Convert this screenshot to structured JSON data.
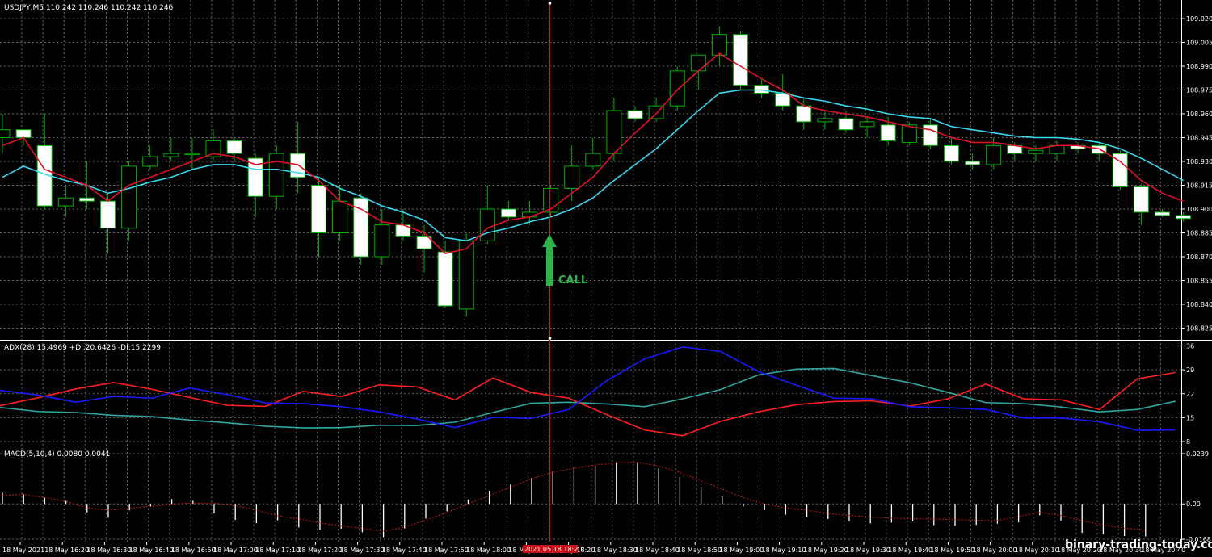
{
  "main": {
    "header": "USDJPY,M5  110.242 110.246 110.242 110.246",
    "price_ticks": [
      "109.020",
      "109.005",
      "108.990",
      "108.975",
      "108.960",
      "108.945",
      "108.930",
      "108.915",
      "108.900",
      "108.885",
      "108.870",
      "108.855",
      "108.840",
      "108.825"
    ],
    "call_label": "CALL"
  },
  "adx_panel": {
    "header": "ADX(28) 15.4969 +DI:20.6426 -DI:15.2299",
    "ticks": [
      "36",
      "29",
      "22",
      "15",
      "8"
    ]
  },
  "macd_panel": {
    "header": "MACD(5,10,4) 0.0080 0.0041",
    "ticks": [
      "0.0239",
      "0.00",
      "-0.0168"
    ]
  },
  "time_axis": {
    "labels": [
      "18 May 2021",
      "18 May 16:20",
      "18 May 16:30",
      "18 May 16:40",
      "18 May 16:50",
      "18 May 17:00",
      "18 May 17:10",
      "18 May 17:20",
      "18 May 17:30",
      "18 May 17:40",
      "18 May 17:50",
      "18 May 18:00",
      "18 May 18:10",
      "18 May 18:20",
      "18 May 18:30",
      "18 May 18:40",
      "18 May 18:50",
      "18 May 19:00",
      "18 May 19:10",
      "18 May 19:20",
      "18 May 19:30",
      "18 May 19:40",
      "18 May 19:50",
      "18 May 20:00",
      "18 May 20:10",
      "18 May 20:20",
      "18 May 20:30",
      "18 May 20:40"
    ],
    "highlight": "2021.05.18 18:20"
  },
  "watermark": "binary-trading-today.com",
  "colors": {
    "background": "#000000",
    "grid": "#8a8a8a",
    "bull": "#00b400",
    "bear_body": "#ffffff",
    "ma_fast": "#e0102a",
    "ma_slow": "#38d7ee",
    "adx": "#2fa7a0",
    "plus_di": "#1a1aff",
    "minus_di": "#ff1f1f",
    "macd_hist": "#ffffff",
    "macd_signal": "#c01818",
    "cursor": "#d01515",
    "call": "#2db34a"
  },
  "chart_data": {
    "type": "candlestick",
    "symbol": "USDJPY",
    "timeframe": "M5",
    "candles": [
      {
        "o": 108.945,
        "h": 108.96,
        "l": 108.935,
        "c": 108.95
      },
      {
        "o": 108.95,
        "h": 108.95,
        "l": 108.94,
        "c": 108.945
      },
      {
        "o": 108.94,
        "h": 108.96,
        "l": 108.9,
        "c": 108.902
      },
      {
        "o": 108.902,
        "h": 108.915,
        "l": 108.895,
        "c": 108.907
      },
      {
        "o": 108.907,
        "h": 108.93,
        "l": 108.9,
        "c": 108.905
      },
      {
        "o": 108.905,
        "h": 108.91,
        "l": 108.872,
        "c": 108.888
      },
      {
        "o": 108.888,
        "h": 108.93,
        "l": 108.88,
        "c": 108.927
      },
      {
        "o": 108.927,
        "h": 108.94,
        "l": 108.925,
        "c": 108.933
      },
      {
        "o": 108.933,
        "h": 108.945,
        "l": 108.93,
        "c": 108.935
      },
      {
        "o": 108.935,
        "h": 108.945,
        "l": 108.925,
        "c": 108.935
      },
      {
        "o": 108.933,
        "h": 108.95,
        "l": 108.93,
        "c": 108.943
      },
      {
        "o": 108.943,
        "h": 108.945,
        "l": 108.93,
        "c": 108.935
      },
      {
        "o": 108.932,
        "h": 108.935,
        "l": 108.895,
        "c": 108.908
      },
      {
        "o": 108.908,
        "h": 108.94,
        "l": 108.9,
        "c": 108.935
      },
      {
        "o": 108.935,
        "h": 108.955,
        "l": 108.91,
        "c": 108.92
      },
      {
        "o": 108.915,
        "h": 108.92,
        "l": 108.87,
        "c": 108.885
      },
      {
        "o": 108.885,
        "h": 108.915,
        "l": 108.88,
        "c": 108.905
      },
      {
        "o": 108.907,
        "h": 108.91,
        "l": 108.865,
        "c": 108.87
      },
      {
        "o": 108.87,
        "h": 108.9,
        "l": 108.865,
        "c": 108.89
      },
      {
        "o": 108.89,
        "h": 108.9,
        "l": 108.88,
        "c": 108.883
      },
      {
        "o": 108.883,
        "h": 108.89,
        "l": 108.86,
        "c": 108.875
      },
      {
        "o": 108.873,
        "h": 108.88,
        "l": 108.838,
        "c": 108.839
      },
      {
        "o": 108.837,
        "h": 108.885,
        "l": 108.832,
        "c": 108.88
      },
      {
        "o": 108.88,
        "h": 108.915,
        "l": 108.878,
        "c": 108.9
      },
      {
        "o": 108.9,
        "h": 108.905,
        "l": 108.893,
        "c": 108.895
      },
      {
        "o": 108.895,
        "h": 108.905,
        "l": 108.89,
        "c": 108.898
      },
      {
        "o": 108.898,
        "h": 108.915,
        "l": 108.895,
        "c": 108.913
      },
      {
        "o": 108.913,
        "h": 108.94,
        "l": 108.905,
        "c": 108.927
      },
      {
        "o": 108.927,
        "h": 108.945,
        "l": 108.925,
        "c": 108.935
      },
      {
        "o": 108.935,
        "h": 108.97,
        "l": 108.93,
        "c": 108.962
      },
      {
        "o": 108.962,
        "h": 108.965,
        "l": 108.955,
        "c": 108.957
      },
      {
        "o": 108.957,
        "h": 108.97,
        "l": 108.955,
        "c": 108.965
      },
      {
        "o": 108.965,
        "h": 108.99,
        "l": 108.962,
        "c": 108.987
      },
      {
        "o": 108.987,
        "h": 108.995,
        "l": 108.975,
        "c": 108.997
      },
      {
        "o": 108.997,
        "h": 109.015,
        "l": 108.99,
        "c": 109.01
      },
      {
        "o": 109.01,
        "h": 109.012,
        "l": 108.975,
        "c": 108.978
      },
      {
        "o": 108.978,
        "h": 108.982,
        "l": 108.97,
        "c": 108.973
      },
      {
        "o": 108.973,
        "h": 108.985,
        "l": 108.962,
        "c": 108.965
      },
      {
        "o": 108.965,
        "h": 108.97,
        "l": 108.95,
        "c": 108.955
      },
      {
        "o": 108.955,
        "h": 108.962,
        "l": 108.95,
        "c": 108.957
      },
      {
        "o": 108.957,
        "h": 108.962,
        "l": 108.948,
        "c": 108.95
      },
      {
        "o": 108.952,
        "h": 108.958,
        "l": 108.945,
        "c": 108.955
      },
      {
        "o": 108.953,
        "h": 108.958,
        "l": 108.94,
        "c": 108.943
      },
      {
        "o": 108.942,
        "h": 108.955,
        "l": 108.94,
        "c": 108.953
      },
      {
        "o": 108.953,
        "h": 108.957,
        "l": 108.938,
        "c": 108.94
      },
      {
        "o": 108.94,
        "h": 108.945,
        "l": 108.928,
        "c": 108.93
      },
      {
        "o": 108.93,
        "h": 108.935,
        "l": 108.925,
        "c": 108.928
      },
      {
        "o": 108.928,
        "h": 108.945,
        "l": 108.925,
        "c": 108.94
      },
      {
        "o": 108.94,
        "h": 108.942,
        "l": 108.93,
        "c": 108.935
      },
      {
        "o": 108.935,
        "h": 108.94,
        "l": 108.93,
        "c": 108.937
      },
      {
        "o": 108.935,
        "h": 108.943,
        "l": 108.93,
        "c": 108.94
      },
      {
        "o": 108.94,
        "h": 108.942,
        "l": 108.935,
        "c": 108.938
      },
      {
        "o": 108.94,
        "h": 108.942,
        "l": 108.93,
        "c": 108.935
      },
      {
        "o": 108.935,
        "h": 108.937,
        "l": 108.912,
        "c": 108.914
      },
      {
        "o": 108.914,
        "h": 108.916,
        "l": 108.89,
        "c": 108.898
      },
      {
        "o": 108.898,
        "h": 108.9,
        "l": 108.895,
        "c": 108.896
      },
      {
        "o": 108.896,
        "h": 108.898,
        "l": 108.892,
        "c": 108.894
      }
    ],
    "ma_fast": [
      108.94,
      108.945,
      108.925,
      108.92,
      108.915,
      108.905,
      108.915,
      108.92,
      108.925,
      108.93,
      108.935,
      108.933,
      108.928,
      108.93,
      108.928,
      108.918,
      108.905,
      108.9,
      108.892,
      108.89,
      108.885,
      108.872,
      108.875,
      108.888,
      108.893,
      108.895,
      108.9,
      108.91,
      108.92,
      108.935,
      108.948,
      108.96,
      108.975,
      108.987,
      108.998,
      108.99,
      108.982,
      108.975,
      108.965,
      108.962,
      108.96,
      108.958,
      108.955,
      108.952,
      108.95,
      108.945,
      108.942,
      108.942,
      108.94,
      108.938,
      108.94,
      108.94,
      108.938,
      108.93,
      108.918,
      108.91,
      108.905
    ],
    "ma_slow": [
      108.92,
      108.927,
      108.922,
      108.918,
      108.915,
      108.91,
      108.913,
      108.917,
      108.92,
      108.925,
      108.928,
      108.928,
      108.925,
      108.925,
      108.923,
      108.92,
      108.913,
      108.908,
      108.902,
      108.898,
      108.893,
      108.882,
      108.88,
      108.885,
      108.888,
      108.892,
      108.895,
      108.9,
      108.907,
      108.918,
      108.928,
      108.938,
      108.95,
      108.962,
      108.973,
      108.975,
      108.975,
      108.973,
      108.97,
      108.968,
      108.965,
      108.963,
      108.96,
      108.958,
      108.957,
      108.952,
      108.95,
      108.948,
      108.946,
      108.945,
      108.945,
      108.944,
      108.942,
      108.938,
      108.932,
      108.925,
      108.918
    ],
    "adx_ylim": [
      8,
      36
    ],
    "adx": [
      18,
      16.8,
      16.5,
      15.7,
      15.3,
      14.3,
      13.5,
      12.5,
      12,
      12.1,
      12.8,
      12.7,
      13.7,
      16.5,
      19.2,
      19.5,
      19,
      18.2,
      20.5,
      23.2,
      27.5,
      29.2,
      29.4,
      27.3,
      25.2,
      22.4,
      19.4,
      19.1,
      18.1,
      16.7,
      17.4,
      19.8
    ],
    "plus_di": [
      23,
      21.6,
      19.5,
      21.2,
      20.7,
      23.7,
      21.7,
      19.3,
      19.1,
      18.2,
      16.7,
      14.6,
      12.1,
      15.1,
      14.8,
      17.4,
      25.8,
      32.2,
      35.7,
      34.4,
      28.5,
      24.5,
      20.7,
      20.5,
      18.2,
      17.9,
      17.4,
      14.9,
      14.9,
      13.8,
      11.3,
      11.4
    ],
    "minus_di": [
      18.5,
      20.8,
      23.4,
      25.3,
      23.3,
      20.9,
      18.6,
      18.3,
      22.7,
      21.2,
      24.6,
      24,
      20.2,
      26.6,
      22.4,
      20.7,
      15.9,
      11.4,
      9.7,
      13.9,
      16.7,
      18.8,
      19.7,
      19.9,
      18.4,
      20.5,
      24.8,
      20.5,
      20.2,
      17.4,
      26.4,
      28.2
    ],
    "macd_ylim": [
      -0.0168,
      0.0239
    ],
    "macd_hist": [
      0.0053,
      0.0046,
      0.0032,
      0.0014,
      -0.004,
      -0.0066,
      -0.0031,
      -0.0012,
      0.0023,
      0.0015,
      -0.0045,
      -0.0076,
      -0.0092,
      -0.0078,
      -0.0112,
      -0.0124,
      -0.0118,
      -0.0135,
      -0.0158,
      -0.0117,
      -0.007,
      -0.0035,
      0.002,
      0.0063,
      0.0092,
      0.0124,
      0.0154,
      0.0172,
      0.0186,
      0.0198,
      0.02,
      0.0169,
      0.0129,
      0.0082,
      0.0035,
      -0.0012,
      -0.003,
      -0.0051,
      -0.0062,
      -0.0072,
      -0.0082,
      -0.0093,
      -0.0089,
      -0.0082,
      -0.0101,
      -0.0104,
      -0.01,
      -0.0094,
      -0.0088,
      -0.0054,
      -0.008,
      -0.0138,
      -0.0144,
      -0.0153,
      -0.0155
    ],
    "macd_signal": [
      0.004,
      0.0045,
      0.003,
      0.0012,
      -0.0018,
      -0.003,
      -0.002,
      -0.0012,
      0.0,
      0.0004,
      0.0004,
      -0.0008,
      -0.003,
      -0.0056,
      -0.0072,
      -0.009,
      -0.0104,
      -0.0116,
      -0.013,
      -0.011,
      -0.0078,
      -0.004,
      0.0,
      0.004,
      0.008,
      0.012,
      0.015,
      0.017,
      0.0185,
      0.0195,
      0.0198,
      0.018,
      0.015,
      0.011,
      0.007,
      0.003,
      0.0,
      -0.002,
      -0.003,
      -0.0045,
      -0.0055,
      -0.0062,
      -0.0068,
      -0.007,
      -0.0072,
      -0.0075,
      -0.0078,
      -0.008,
      -0.006,
      -0.004,
      -0.0055,
      -0.008,
      -0.01,
      -0.0115,
      -0.0125
    ]
  }
}
